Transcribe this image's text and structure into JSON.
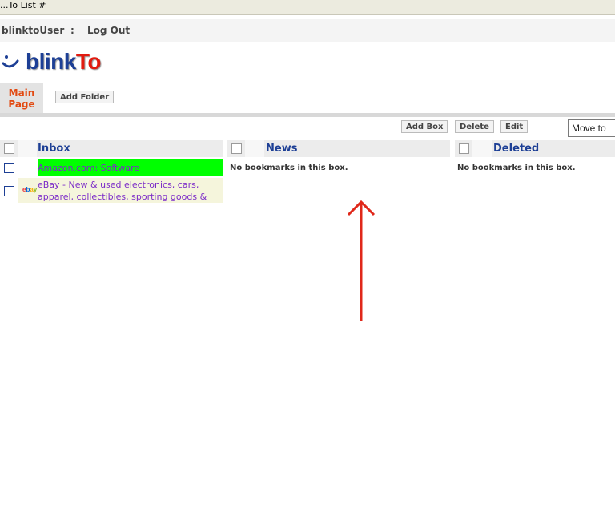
{
  "window": {
    "title": "...To List #"
  },
  "user": {
    "name": "blinktoUser",
    "separator": ":",
    "logout": "Log Out"
  },
  "logo": {
    "part1": "blink",
    "part2": "To"
  },
  "tabs": {
    "main_line1": "Main",
    "main_line2": "Page",
    "add_folder": "Add Folder"
  },
  "toolbar": {
    "add_box": "Add Box",
    "delete": "Delete",
    "edit": "Edit",
    "move_to": "Move to"
  },
  "boxes": [
    {
      "title": "Inbox",
      "bookmarks": [
        {
          "title": "Amazon.com: Software",
          "highlight": "#00ff00",
          "has_favicon": false
        },
        {
          "title_line1": "eBay - New & used electronics, cars,",
          "title_line2": "apparel, collectibles, sporting goods &",
          "favicon": "ebay-icon",
          "bg": "#f5f5dc"
        }
      ]
    },
    {
      "title": "News",
      "empty_message": "No bookmarks in this box."
    },
    {
      "title": "Deleted",
      "empty_message": "No bookmarks in this box."
    }
  ],
  "colors": {
    "accent": "#1d3f95",
    "logo_red": "#e11b10",
    "tab_active": "#e24a12",
    "link": "#7b2bc8",
    "annotation_arrow": "#e0281a"
  }
}
